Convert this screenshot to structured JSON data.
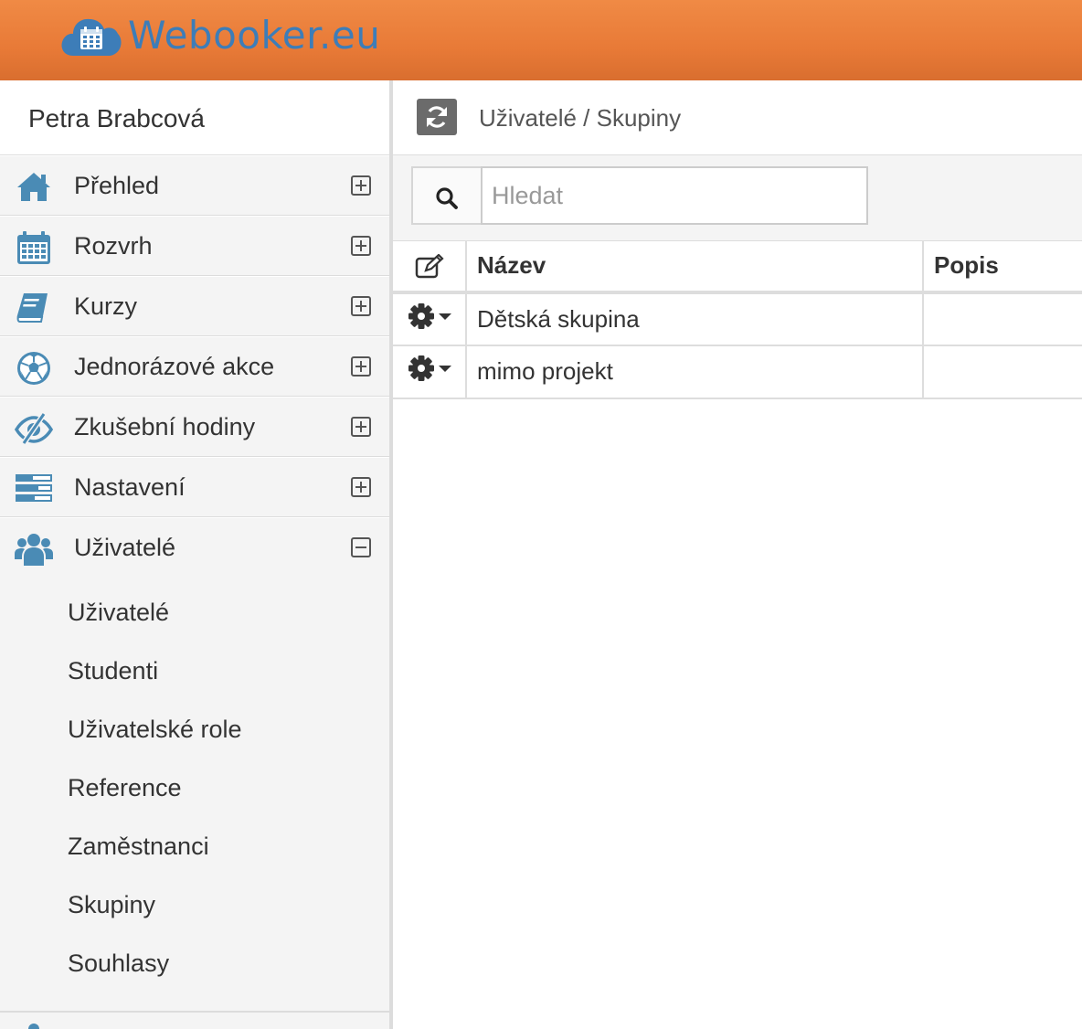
{
  "app": {
    "logo_text": "Webooker.eu",
    "accent": "#e97d39",
    "brand_blue": "#3d7db8",
    "icon_blue": "#4a8bb5"
  },
  "sidebar": {
    "user_name": "Petra Brabcová",
    "items": [
      {
        "label": "Přehled",
        "icon": "home-icon",
        "expanded": false
      },
      {
        "label": "Rozvrh",
        "icon": "calendar-icon",
        "expanded": false
      },
      {
        "label": "Kurzy",
        "icon": "book-icon",
        "expanded": false
      },
      {
        "label": "Jednorázové akce",
        "icon": "soccer-ball-icon",
        "expanded": false
      },
      {
        "label": "Zkušební hodiny",
        "icon": "eye-slash-icon",
        "expanded": false
      },
      {
        "label": "Nastavení",
        "icon": "settings-list-icon",
        "expanded": false
      },
      {
        "label": "Uživatelé",
        "icon": "users-icon",
        "expanded": true
      }
    ],
    "sub_items": [
      "Uživatelé",
      "Studenti",
      "Uživatelské role",
      "Reference",
      "Zaměstnanci",
      "Skupiny",
      "Souhlasy"
    ]
  },
  "header": {
    "breadcrumb": "Uživatelé / Skupiny"
  },
  "search": {
    "placeholder": "Hledat"
  },
  "table": {
    "columns": [
      "Název",
      "Popis"
    ],
    "rows": [
      {
        "name": "Dětská skupina",
        "desc": ""
      },
      {
        "name": "mimo projekt",
        "desc": ""
      }
    ]
  }
}
